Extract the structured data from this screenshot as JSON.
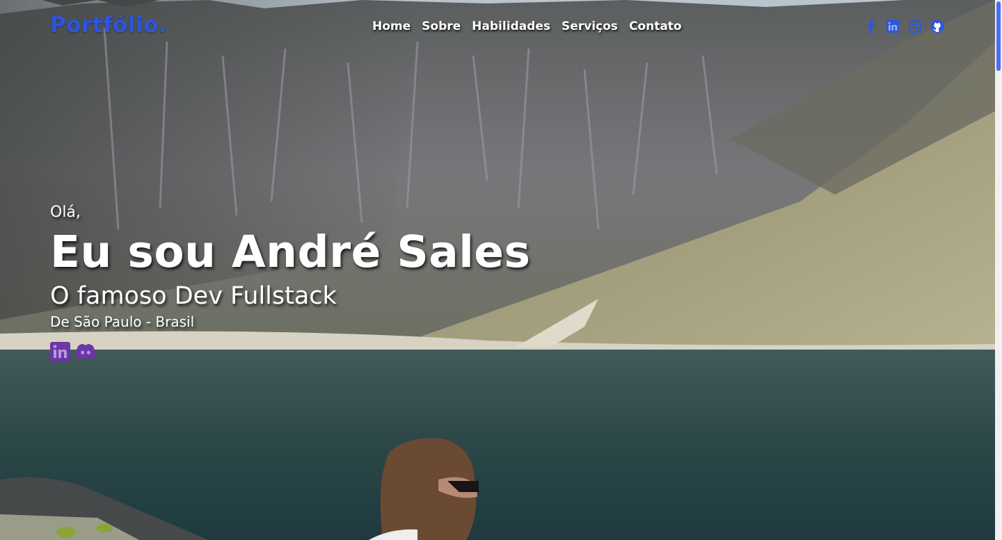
{
  "header": {
    "logo_text": "Portfólio",
    "logo_dot": ".",
    "nav": [
      "Home",
      "Sobre",
      "Habilidades",
      "Serviços",
      "Contato"
    ],
    "social_icons": [
      "facebook-icon",
      "linkedin-icon",
      "instagram-icon",
      "github-icon"
    ]
  },
  "hero": {
    "greeting": "Olá,",
    "name": "Eu sou André Sales",
    "role": "O famoso Dev Fullstack",
    "location": "De São Paulo - Brasil",
    "social_icons": [
      "linkedin-icon",
      "discord-icon"
    ]
  },
  "colors": {
    "accent": "#2c55e0",
    "hero_icon": "#6a36a8"
  }
}
